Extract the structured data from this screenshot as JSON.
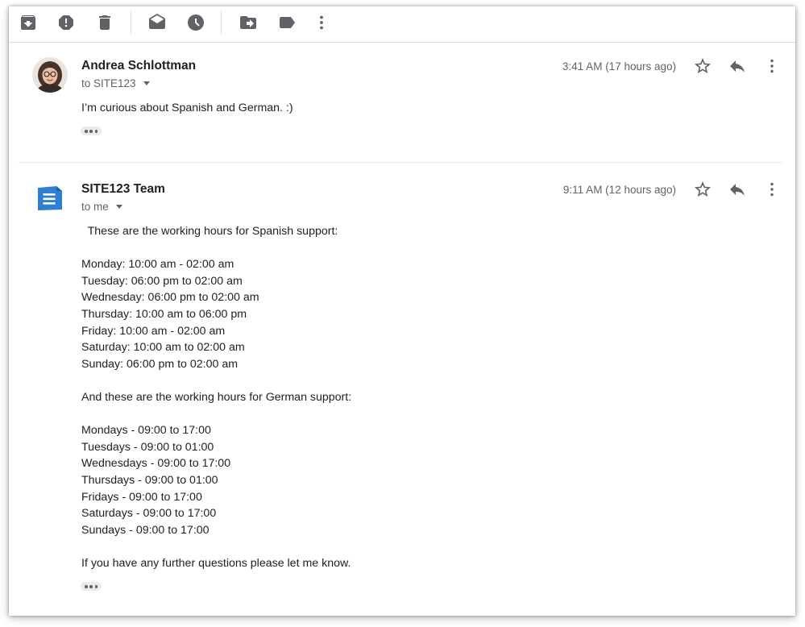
{
  "toolbar": {
    "icons": [
      "archive-icon",
      "report-spam-icon",
      "delete-icon",
      "mark-as-unread-icon",
      "snooze-icon",
      "move-to-icon",
      "label-icon",
      "more-vert-icon"
    ]
  },
  "messages": [
    {
      "sender": "Andrea Schlottman",
      "recipient": "to SITE123",
      "time": "3:41 AM (17 hours ago)",
      "body": "I’m curious about Spanish and German. :)"
    },
    {
      "sender": "SITE123 Team",
      "recipient": "to me",
      "time": "9:11 AM (12 hours ago)",
      "body": "  These are the working hours for Spanish support:\n\nMonday: 10:00 am - 02:00 am\nTuesday: 06:00 pm to 02:00 am\nWednesday: 06:00 pm to 02:00 am\nThursday: 10:00 am to 06:00 pm\nFriday: 10:00 am - 02:00 am\nSaturday: 10:00 am to 02:00 am\nSunday: 06:00 pm to 02:00 am\n\nAnd these are the working hours for German support:\n\nMondays - 09:00 to 17:00\nTuesdays - 09:00 to 01:00\nWednesdays - 09:00 to 17:00\nThursdays - 09:00 to 01:00\nFridays - 09:00 to 17:00\nSaturdays - 09:00 to 17:00\nSundays - 09:00 to 17:00\n\nIf you have any further questions please let me know."
    }
  ],
  "colors": {
    "icon_gray": "#5f6368",
    "site123_blue": "#2f7fd1",
    "divider": "#dadce0"
  }
}
